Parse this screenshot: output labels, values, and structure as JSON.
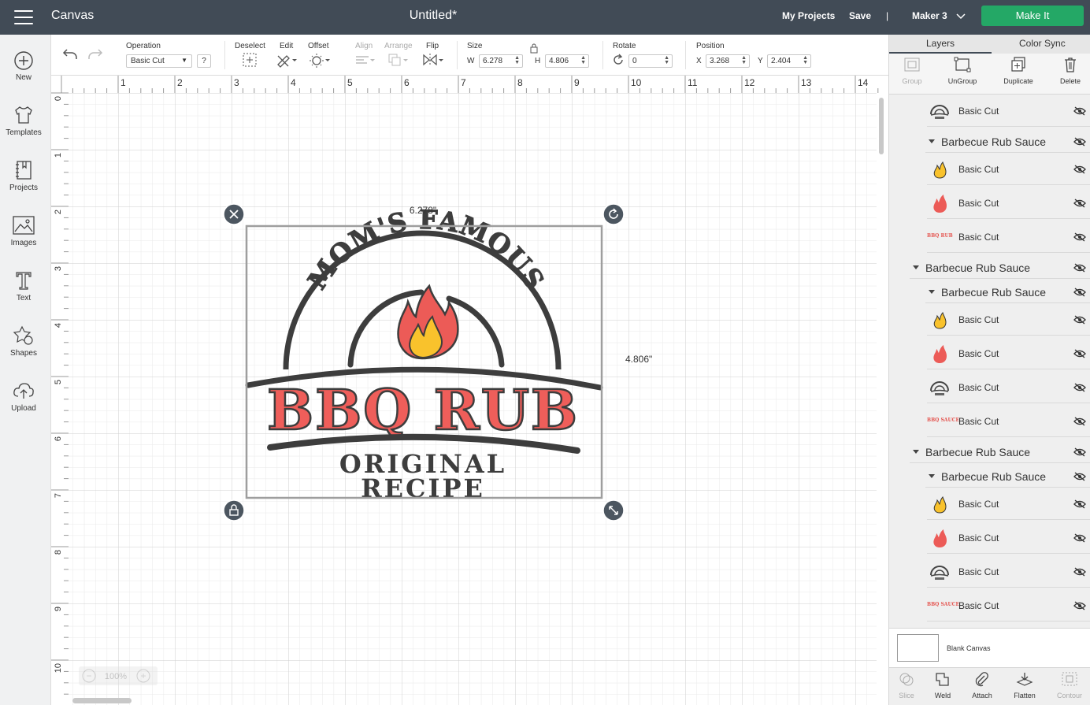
{
  "header": {
    "app_name": "Canvas",
    "doc_title": "Untitled*",
    "my_projects": "My Projects",
    "save": "Save",
    "divider": "|",
    "machine": "Maker 3",
    "make_it": "Make It",
    "bg_color": "#414b56",
    "accent_color": "#24a866"
  },
  "sidebar": {
    "items": [
      {
        "label": "New",
        "icon": "plus-circle-icon"
      },
      {
        "label": "Templates",
        "icon": "tshirt-icon"
      },
      {
        "label": "Projects",
        "icon": "notebook-icon"
      },
      {
        "label": "Images",
        "icon": "image-icon"
      },
      {
        "label": "Text",
        "icon": "text-t-icon"
      },
      {
        "label": "Shapes",
        "icon": "shapes-icon"
      },
      {
        "label": "Upload",
        "icon": "cloud-upload-icon"
      }
    ]
  },
  "toolbar": {
    "operation_label": "Operation",
    "operation_value": "Basic Cut",
    "help": "?",
    "deselect": "Deselect",
    "edit": "Edit",
    "offset": "Offset",
    "align": "Align",
    "arrange": "Arrange",
    "flip": "Flip",
    "size_label": "Size",
    "w_label": "W",
    "w_value": "6.278",
    "h_label": "H",
    "h_value": "4.806",
    "rotate_label": "Rotate",
    "rotate_value": "0",
    "position_label": "Position",
    "x_label": "X",
    "x_value": "3.268",
    "y_label": "Y",
    "y_value": "2.404"
  },
  "canvas": {
    "ruler_x": [
      "1",
      "2",
      "3",
      "4",
      "5",
      "6",
      "7",
      "8",
      "9",
      "10",
      "11",
      "12",
      "13",
      "14"
    ],
    "ruler_y": [
      "0",
      "1",
      "2",
      "3",
      "4",
      "5",
      "6",
      "7",
      "8",
      "9",
      "10"
    ],
    "width_label": "6.278\"",
    "height_label": "4.806\"",
    "zoom": "100%",
    "zoom_minus": "−",
    "zoom_plus": "+",
    "design": {
      "arc_text": "MOM'S FAMOUS",
      "main_text": "BBQ RUB",
      "sub_text_1": "ORIGINAL",
      "sub_text_2": "RECIPE",
      "dark_color": "#3d3d3d",
      "red_color": "#ef5e5a",
      "yellow_color": "#f9c22c",
      "flame_color": "#ec5b57"
    }
  },
  "layers_panel": {
    "tab_layers": "Layers",
    "tab_color_sync": "Color Sync",
    "actions": [
      {
        "label": "Group",
        "icon": "group-icon",
        "disabled": true
      },
      {
        "label": "UnGroup",
        "icon": "ungroup-icon",
        "disabled": false
      },
      {
        "label": "Duplicate",
        "icon": "duplicate-icon",
        "disabled": false
      },
      {
        "label": "Delete",
        "icon": "trash-icon",
        "disabled": false
      }
    ],
    "rows": [
      {
        "kind": "layer",
        "indent": 1,
        "label": "Basic Cut",
        "thumb": "emblem"
      },
      {
        "kind": "group",
        "indent": 1,
        "label": "Barbecue Rub Sauce"
      },
      {
        "kind": "layer",
        "indent": 1,
        "label": "Basic Cut",
        "thumb": "flame-yellow"
      },
      {
        "kind": "layer",
        "indent": 1,
        "label": "Basic Cut",
        "thumb": "flame-red"
      },
      {
        "kind": "layer",
        "indent": 1,
        "label": "Basic Cut",
        "thumb": "text-red",
        "thumb_text": "BBQ RUB"
      },
      {
        "kind": "group",
        "indent": 0,
        "label": "Barbecue Rub Sauce"
      },
      {
        "kind": "group",
        "indent": 1,
        "label": "Barbecue Rub Sauce"
      },
      {
        "kind": "layer",
        "indent": 1,
        "label": "Basic Cut",
        "thumb": "flame-yellow"
      },
      {
        "kind": "layer",
        "indent": 1,
        "label": "Basic Cut",
        "thumb": "flame-red"
      },
      {
        "kind": "layer",
        "indent": 1,
        "label": "Basic Cut",
        "thumb": "emblem"
      },
      {
        "kind": "layer",
        "indent": 1,
        "label": "Basic Cut",
        "thumb": "text-red",
        "thumb_text": "BBQ SAUCE"
      },
      {
        "kind": "group",
        "indent": 0,
        "label": "Barbecue Rub Sauce"
      },
      {
        "kind": "group",
        "indent": 1,
        "label": "Barbecue Rub Sauce"
      },
      {
        "kind": "layer",
        "indent": 1,
        "label": "Basic Cut",
        "thumb": "flame-yellow"
      },
      {
        "kind": "layer",
        "indent": 1,
        "label": "Basic Cut",
        "thumb": "flame-red"
      },
      {
        "kind": "layer",
        "indent": 1,
        "label": "Basic Cut",
        "thumb": "emblem"
      },
      {
        "kind": "layer",
        "indent": 1,
        "label": "Basic Cut",
        "thumb": "text-red",
        "thumb_text": "BBQ SAUCE"
      }
    ],
    "blank_canvas": "Blank Canvas",
    "bottom_actions": [
      {
        "label": "Slice",
        "icon": "slice-icon",
        "disabled": true
      },
      {
        "label": "Weld",
        "icon": "weld-icon",
        "disabled": false
      },
      {
        "label": "Attach",
        "icon": "attach-icon",
        "disabled": false
      },
      {
        "label": "Flatten",
        "icon": "flatten-icon",
        "disabled": false
      },
      {
        "label": "Contour",
        "icon": "contour-icon",
        "disabled": true
      }
    ]
  }
}
